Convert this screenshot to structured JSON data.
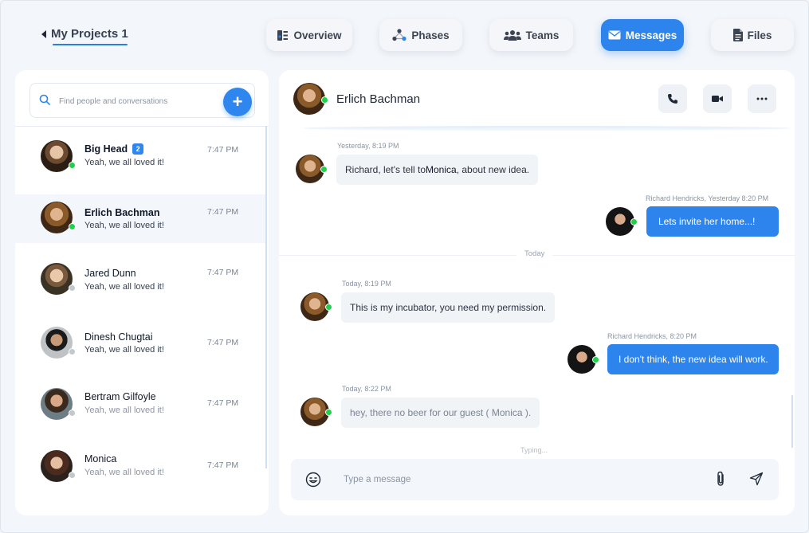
{
  "project": {
    "title": "My Projects 1"
  },
  "tabs": [
    {
      "label": "Overview",
      "icon": "overview-icon",
      "active": false
    },
    {
      "label": "Phases",
      "icon": "phases-icon",
      "active": false
    },
    {
      "label": "Teams",
      "icon": "teams-icon",
      "active": false
    },
    {
      "label": "Messages",
      "icon": "mail-icon",
      "active": true
    },
    {
      "label": "Files",
      "icon": "file-icon",
      "active": false
    }
  ],
  "search": {
    "placeholder": "Find people and conversations"
  },
  "contacts": [
    {
      "name": "Big Head",
      "badge": "2",
      "last_message": "Yeah, we all loved it!",
      "time": "7:47 PM",
      "online": true
    },
    {
      "name": "Erlich Bachman",
      "last_message": "Yeah, we all loved it!",
      "time": "7:47 PM",
      "online": true,
      "selected": true
    },
    {
      "name": "Jared Dunn",
      "last_message": "Yeah, we all loved it!",
      "time": "7:47 PM",
      "online": false
    },
    {
      "name": "Dinesh Chugtai",
      "last_message": "Yeah, we all loved it!",
      "time": "7:47 PM",
      "online": false
    },
    {
      "name": "Bertram Gilfoyle",
      "last_message": "Yeah, we all loved it!",
      "time": "7:47 PM",
      "online": false
    },
    {
      "name": "Monica",
      "last_message": "Yeah, we all loved it!",
      "time": "7:47 PM",
      "online": false
    }
  ],
  "chat": {
    "contact_name": "Erlich Bachman",
    "messages": [
      {
        "meta": "Yesterday, 8:19 PM",
        "text_before": "Richard, let's tell to ",
        "text_highlight": "Monica",
        "text_after": ", about new idea.",
        "direction": "in"
      },
      {
        "meta": "Richard Hendricks, Yesterday 8:20 PM",
        "text": "Lets invite her home...!",
        "direction": "out"
      },
      {
        "meta": "Today, 8:19 PM",
        "text": "This is my incubator, you need my permission.",
        "direction": "in"
      },
      {
        "meta": "Richard Hendricks, 8:20 PM",
        "text": "I don't think, the new idea will work.",
        "direction": "out"
      },
      {
        "meta": "Today, 8:22 PM",
        "text": "hey, there no beer for our guest ( Monica ).",
        "direction": "in"
      }
    ],
    "day_divider": "Today",
    "typing": "Typing...",
    "composer_placeholder": "Type a message"
  },
  "colors": {
    "accent": "#2c84ec",
    "online": "#1fd14a",
    "offline": "#c2c8d0"
  }
}
